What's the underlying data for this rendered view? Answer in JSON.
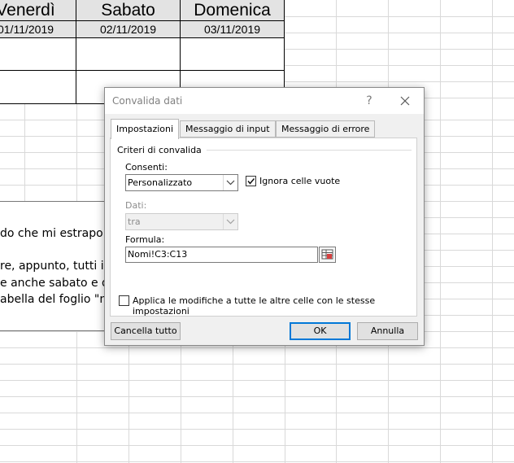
{
  "sheet": {
    "headers": [
      "Venerdì",
      "Sabato",
      "Domenica"
    ],
    "dates": [
      "01/11/2019",
      "02/11/2019",
      "03/11/2019"
    ],
    "notes": [
      "do che mi estrapoli i",
      "re, appunto, tutti i no",
      "e anche sabato e don",
      "abella del foglio \"nor"
    ]
  },
  "dialog": {
    "title": "Convalida dati",
    "help": "?",
    "tabs": [
      "Impostazioni",
      "Messaggio di input",
      "Messaggio di errore"
    ],
    "active_tab": 0,
    "criteria_heading": "Criteri di convalida",
    "allow_label": "Consenti:",
    "allow_value": "Personalizzato",
    "ignore_blank_label": "Ignora celle vuote",
    "ignore_blank_checked": true,
    "data_label": "Dati:",
    "data_value": "tra",
    "formula_label": "Formula:",
    "formula_value": "Nomi!C3:C13",
    "apply_all_label": "Applica le modifiche a tutte le altre celle con le stesse impostazioni",
    "apply_all_checked": false,
    "buttons": {
      "clear_all": "Cancella tutto",
      "ok": "OK",
      "cancel": "Annulla"
    },
    "colors": {
      "accent": "#0078d7",
      "dialog_bg": "#f0f0f0",
      "header_fill": "#e3e3e3"
    }
  }
}
